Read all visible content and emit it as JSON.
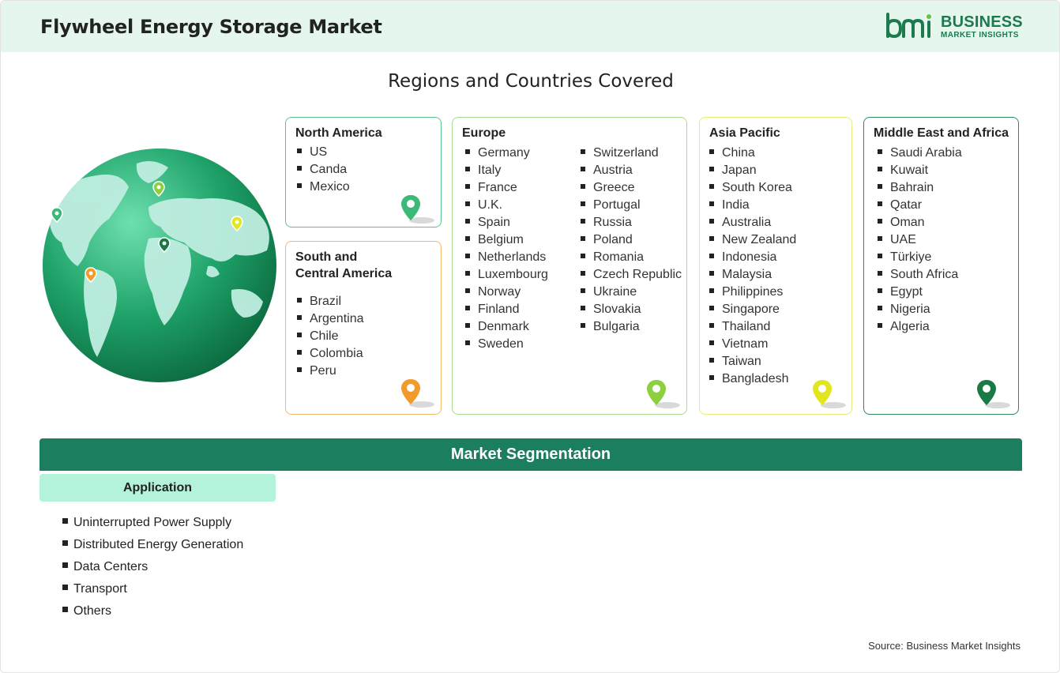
{
  "header": {
    "title": "Flywheel Energy Storage Market",
    "logo": {
      "name": "BUSINESS",
      "subtitle": "MARKET INSIGHTS",
      "mark": "bmi"
    }
  },
  "regions": {
    "heading": "Regions and Countries Covered",
    "north_america": {
      "title": "North America",
      "pin_color": "#3cb878",
      "countries": [
        "US",
        "Canda",
        "Mexico"
      ]
    },
    "south_central_america": {
      "title_line1": "South and",
      "title_line2": "Central America",
      "pin_color": "#f29b2b",
      "countries": [
        "Brazil",
        "Argentina",
        "Chile",
        "Colombia",
        "Peru"
      ]
    },
    "europe": {
      "title": "Europe",
      "pin_color": "#8ccf3f",
      "countries_col1": [
        "Germany",
        "Italy",
        "France",
        "U.K.",
        "Spain",
        "Belgium",
        "Netherlands",
        "Luxembourg",
        "Norway",
        "Finland",
        "Denmark",
        "Sweden"
      ],
      "countries_col2": [
        "Switzerland",
        "Austria",
        "Greece",
        "Portugal",
        "Russia",
        "Poland",
        "Romania",
        "Czech Republic",
        "Ukraine",
        "Slovakia",
        "Bulgaria"
      ]
    },
    "asia_pacific": {
      "title": "Asia Pacific",
      "pin_color": "#e3e61f",
      "countries": [
        "China",
        "Japan",
        "South Korea",
        "India",
        "Australia",
        "New Zealand",
        "Indonesia",
        "Malaysia",
        "Philippines",
        "Singapore",
        "Thailand",
        "Vietnam",
        "Taiwan",
        "Bangladesh"
      ]
    },
    "middle_east_africa": {
      "title": "Middle East and Africa",
      "pin_color": "#1a7a45",
      "countries": [
        "Saudi Arabia",
        "Kuwait",
        "Bahrain",
        "Qatar",
        "Oman",
        "UAE",
        "Türkiye",
        "South Africa",
        "Egypt",
        "Nigeria",
        "Algeria"
      ]
    }
  },
  "segmentation": {
    "heading": "Market Segmentation",
    "application_label": "Application",
    "applications": [
      "Uninterrupted Power Supply",
      "Distributed Energy Generation",
      "Data Centers",
      "Transport",
      "Others"
    ]
  },
  "footer": {
    "source": "Source: Business Market Insights"
  },
  "colors": {
    "header_bg": "#e5f6ec",
    "segment_bar": "#1b7e5f",
    "application_tab": "#b2f3d9",
    "brand": "#1d7a4e"
  }
}
